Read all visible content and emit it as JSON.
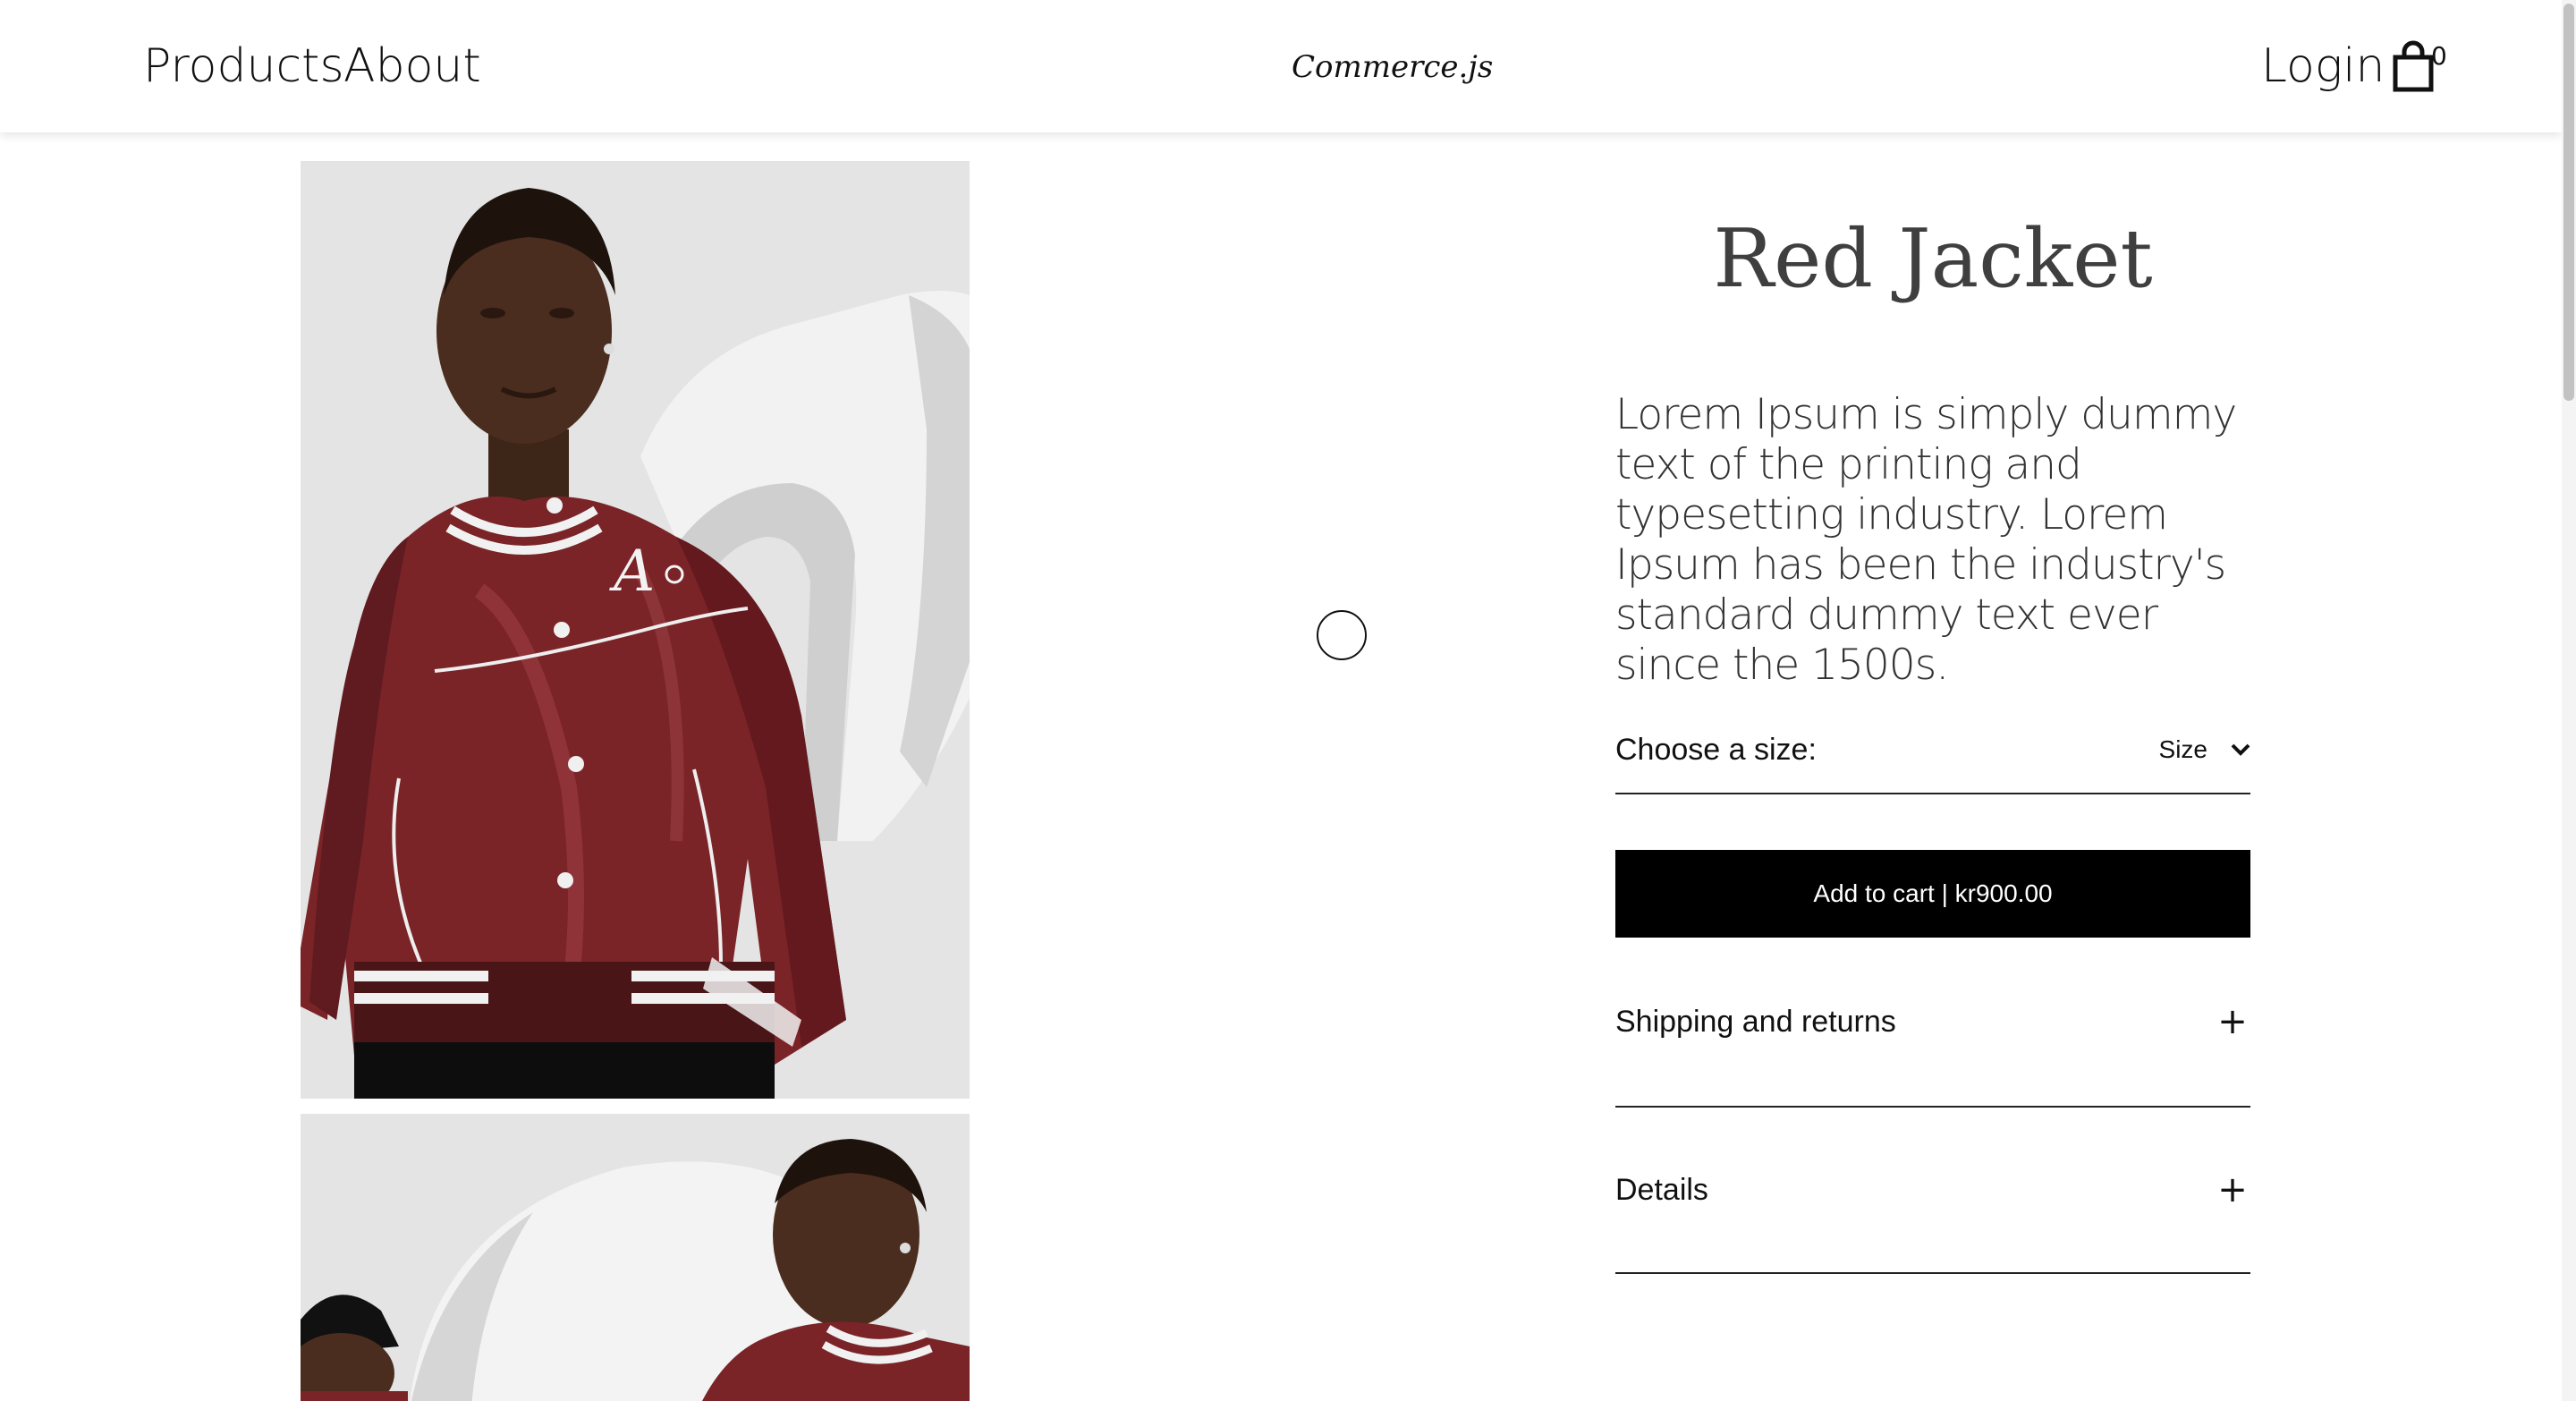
{
  "header": {
    "nav_items": [
      "Products",
      "About"
    ],
    "brand": "Commerce.js",
    "login_label": "Login",
    "cart_count": "0"
  },
  "product": {
    "title": "Red Jacket",
    "description": "Lorem Ipsum is simply dummy text of the printing and typesetting industry. Lorem Ipsum has been the industry's standard dummy text ever since the 1500s.",
    "size_label": "Choose a size:",
    "size_select_value": "Size",
    "add_to_cart_label": "Add to cart | kr900.00",
    "accordions": [
      "Shipping and returns",
      "Details"
    ],
    "accordion_icon": "+"
  },
  "colors": {
    "button_background": "#000000",
    "button_text": "#ffffff",
    "title_text": "#3f3f3f",
    "jacket": "#7a2428",
    "image_background": "#e3e3e3"
  },
  "icons": {
    "cart": "shopping-bag-icon",
    "select": "chevron-down-icon",
    "expand": "plus-icon"
  }
}
